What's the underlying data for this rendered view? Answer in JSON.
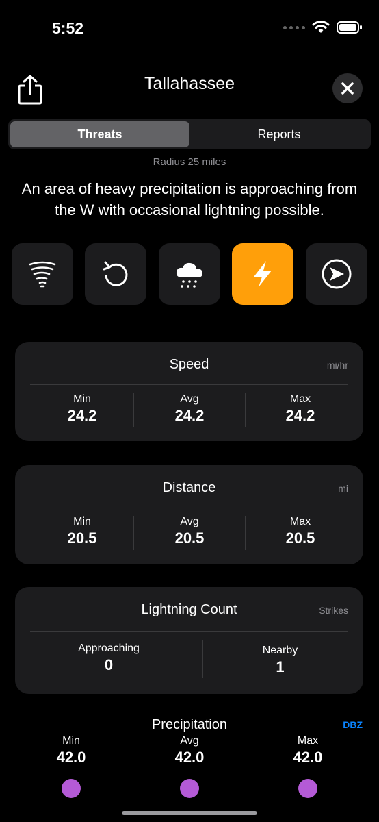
{
  "status": {
    "time": "5:52"
  },
  "header": {
    "title": "Tallahassee"
  },
  "tabs": [
    {
      "label": "Threats",
      "active": true
    },
    {
      "label": "Reports",
      "active": false
    }
  ],
  "radius_text": "Radius 25 miles",
  "summary": "An area of heavy precipitation is approaching from the W with occasional lightning possible.",
  "threat_icons": [
    "tornado-icon",
    "rotation-icon",
    "rain-icon",
    "lightning-icon",
    "direction-icon"
  ],
  "selected_threat": "lightning-icon",
  "accent_color": "#ff9f0a",
  "speed": {
    "title": "Speed",
    "unit": "mi/hr",
    "min_label": "Min",
    "min": "24.2",
    "avg_label": "Avg",
    "avg": "24.2",
    "max_label": "Max",
    "max": "24.2"
  },
  "distance": {
    "title": "Distance",
    "unit": "mi",
    "min_label": "Min",
    "min": "20.5",
    "avg_label": "Avg",
    "avg": "20.5",
    "max_label": "Max",
    "max": "20.5"
  },
  "lightning": {
    "title": "Lightning Count",
    "unit": "Strikes",
    "approaching_label": "Approaching",
    "approaching": "0",
    "nearby_label": "Nearby",
    "nearby": "1"
  },
  "precipitation": {
    "title": "Precipitation",
    "unit": "DBZ",
    "min_label": "Min",
    "min": "42.0",
    "avg_label": "Avg",
    "avg": "42.0",
    "max_label": "Max",
    "max": "42.0"
  }
}
